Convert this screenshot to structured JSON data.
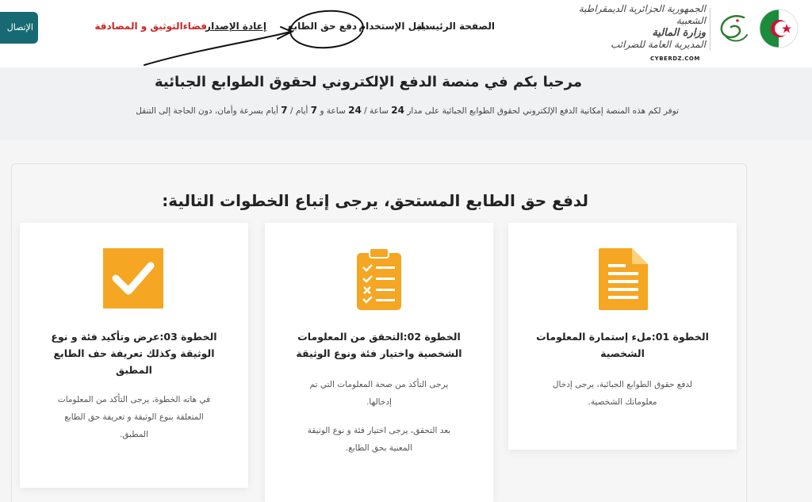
{
  "header": {
    "login_label": "الإتصال",
    "nav": {
      "home": "الصفحة الرئيسية",
      "guide": "دليل الإستخدام",
      "pay": "دفع حق الطابع",
      "reissue": "إعادة الإصدار",
      "verify": "فضاءالتوثيق و المصادقة"
    },
    "brand": {
      "line1": "الجمهورية الجزائرية الديمقراطية الشعبية",
      "line2": "وزارة المالية",
      "line3": "المديرية العامة للضرائب"
    },
    "watermark": "CYBERDZ.COM"
  },
  "hero": {
    "title": "مرحبا بكم في منصة الدفع الإلكتروني لحقوق الطوابع الجبائية",
    "sub_part1": "توفر لكم هذه المنصة إمكانية الدفع الإلكتروني لحقوق الطوابع الجبائية على مدار",
    "sub_24a": "24",
    "sub_part2": "ساعة /",
    "sub_24b": "24",
    "sub_part3": "ساعة و",
    "sub_7a": "7",
    "sub_part4": "أيام /",
    "sub_7b": "7",
    "sub_part5": "أيام بسرعة وأمان، دون الحاجة إلى التنقل"
  },
  "steps": {
    "title": "لدفع حق الطابع المستحق، يرجى إتباع الخطوات التالية:",
    "step1": {
      "title_l1": "الخطوة 01:ملء إستمارة المعلومات",
      "title_l2": "الشخصية",
      "text_l1": "لدفع حقوق الطوابع الجبائية، يرجى إدخال",
      "text_l2": "معلوماتك الشخصية."
    },
    "step2": {
      "title_l1": "الخطوة 02:التحقق من المعلومات",
      "title_l2": "الشخصية واختيار فئة ونوع الوثيقة",
      "text_l1": "يرجى التأكد من صحة المعلومات التي تم",
      "text_l2": "إدخالها.",
      "text_l3": "بعد التحقق، يرجى اختيار فئة و نوع الوثيقة",
      "text_l4": "المعنية بحق الطابع."
    },
    "step3": {
      "title_l1": "الخطوة 03:عرض وتأكيد فئة و نوع",
      "title_l2": "الوثيقة وكذلك تعريفة حف الطابع",
      "title_l3": "المطبق",
      "text_l1": "في هاته الخطوة، يرجى التأكد من المعلومات",
      "text_l2": "المتعلقة بنوع الوثيقة و تعريفة حق الطابع",
      "text_l3": "المطبق."
    }
  },
  "colors": {
    "accent_teal": "#176a73",
    "icon_orange": "#f5a623",
    "nav_red": "#c62828",
    "flag_green": "#1a8c3c",
    "flag_red": "#d21034"
  },
  "icons": [
    "document-icon",
    "checklist-icon",
    "checkmark-icon",
    "algeria-flag-icon",
    "logo-signature-icon"
  ]
}
